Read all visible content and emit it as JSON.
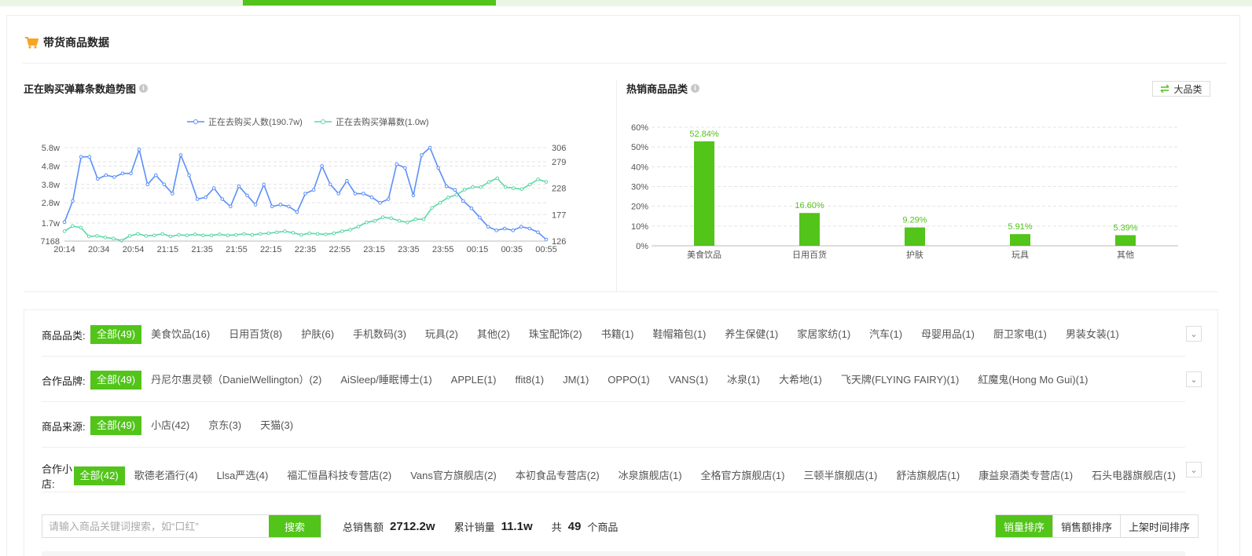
{
  "section": {
    "title": "带货商品数据"
  },
  "trend": {
    "title": "正在购买弹幕条数趋势图",
    "info": "i",
    "legend": [
      "正在去购买人数(190.7w)",
      "正在去购买弹幕数(1.0w)"
    ],
    "series_colors": [
      "#5b8ff9",
      "#5ad8a6"
    ]
  },
  "hot": {
    "title": "热销商品品类",
    "info": "i",
    "toggle_label": "大品类"
  },
  "chart_data": [
    {
      "type": "line",
      "title": "正在购买弹幕条数趋势图",
      "x_ticks": [
        "20:14",
        "20:34",
        "20:54",
        "21:15",
        "21:35",
        "21:55",
        "22:15",
        "22:35",
        "22:55",
        "23:15",
        "23:35",
        "23:55",
        "00:15",
        "00:35",
        "00:55"
      ],
      "y_left_ticks": [
        "7168",
        "1.7w",
        "2.8w",
        "3.8w",
        "4.8w",
        "5.8w"
      ],
      "y_right_ticks": [
        "126",
        "177",
        "228",
        "279",
        "306"
      ],
      "series": [
        {
          "name": "正在去购买人数(190.7w)",
          "axis": "left",
          "values": [
            17500,
            29000,
            53000,
            53000,
            41000,
            43000,
            42000,
            44000,
            44000,
            57000,
            38000,
            43000,
            38000,
            33000,
            54000,
            43000,
            30000,
            31000,
            36000,
            30000,
            26000,
            37000,
            32000,
            27000,
            38000,
            26000,
            27000,
            26000,
            23000,
            33000,
            35000,
            48000,
            38000,
            33000,
            40000,
            33000,
            33000,
            31000,
            28000,
            30000,
            49000,
            47000,
            32000,
            54000,
            58000,
            47000,
            37000,
            35000,
            29000,
            25000,
            20000,
            15000,
            13000,
            14000,
            13000,
            15000,
            14000,
            12000,
            8000
          ]
        },
        {
          "name": "正在去购买弹幕数(1.0w)",
          "axis": "right",
          "values": [
            145,
            155,
            152,
            135,
            136,
            133,
            131,
            127,
            136,
            140,
            136,
            137,
            140,
            135,
            138,
            137,
            139,
            137,
            137,
            139,
            137,
            138,
            140,
            138,
            140,
            141,
            143,
            145,
            142,
            138,
            141,
            140,
            139,
            141,
            145,
            148,
            154,
            162,
            165,
            172,
            170,
            165,
            162,
            168,
            168,
            190,
            200,
            210,
            215,
            225,
            230,
            230,
            240,
            247,
            230,
            228,
            226,
            235,
            245,
            240
          ]
        }
      ]
    },
    {
      "type": "bar",
      "title": "热销商品品类",
      "categories": [
        "美食饮品",
        "日用百货",
        "护肤",
        "玩具",
        "其他"
      ],
      "values": [
        52.84,
        16.6,
        9.29,
        5.91,
        5.39
      ],
      "value_labels": [
        "52.84%",
        "16.60%",
        "9.29%",
        "5.91%",
        "5.39%"
      ],
      "y_ticks": [
        "0%",
        "10%",
        "20%",
        "30%",
        "40%",
        "50%",
        "60%"
      ],
      "ylim": [
        0,
        60
      ],
      "grid": true
    }
  ],
  "filters": {
    "category": {
      "label": "商品品类:",
      "active": "全部(49)",
      "items": [
        "美食饮品(16)",
        "日用百货(8)",
        "护肤(6)",
        "手机数码(3)",
        "玩具(2)",
        "其他(2)",
        "珠宝配饰(2)",
        "书籍(1)",
        "鞋帽箱包(1)",
        "养生保健(1)",
        "家居家纺(1)",
        "汽车(1)",
        "母婴用品(1)",
        "厨卫家电(1)",
        "男装女装(1)"
      ]
    },
    "brand": {
      "label": "合作品牌:",
      "active": "全部(49)",
      "items": [
        "丹尼尔惠灵顿（DanielWellington）(2)",
        "AiSleep/睡眠博士(1)",
        "APPLE(1)",
        "ffit8(1)",
        "JM(1)",
        "OPPO(1)",
        "VANS(1)",
        "冰泉(1)",
        "大希地(1)",
        "飞天牌(FLYING FAIRY)(1)",
        "紅魔鬼(Hong Mo Gui)(1)"
      ]
    },
    "source": {
      "label": "商品来源:",
      "active": "全部(49)",
      "items": [
        "小店(42)",
        "京东(3)",
        "天猫(3)"
      ]
    },
    "shop": {
      "label": "合作小店:",
      "active": "全部(42)",
      "items": [
        "歌德老酒行(4)",
        "Llsa严选(4)",
        "福汇恒昌科技专营店(2)",
        "Vans官方旗舰店(2)",
        "本初食品专营店(2)",
        "冰泉旗舰店(1)",
        "全格官方旗舰店(1)",
        "三顿半旗舰店(1)",
        "舒洁旗舰店(1)",
        "康益泉酒类专营店(1)",
        "石头电器旗舰店(1)"
      ]
    },
    "expand_icon": "chevron-down"
  },
  "search": {
    "placeholder": "请输入商品关键词搜索，如“口红”",
    "button": "搜索"
  },
  "stats": {
    "total_sales_label": "总销售额",
    "total_sales_value": "2712.2w",
    "total_volume_label": "累计销量",
    "total_volume_value": "11.1w",
    "count_prefix": "共",
    "count_value": "49",
    "count_suffix": "个商品"
  },
  "sort": [
    "销量排序",
    "销售额排序",
    "上架时间排序"
  ]
}
